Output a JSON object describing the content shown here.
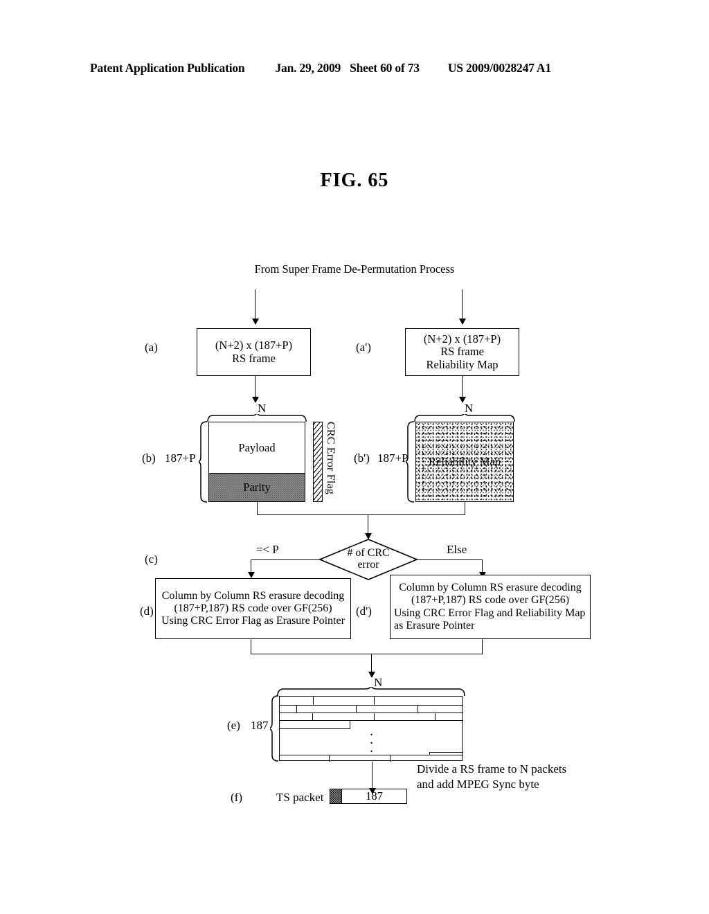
{
  "header": {
    "publication": "Patent Application Publication",
    "date": "Jan. 29, 2009",
    "sheet": "Sheet 60 of 73",
    "number": "US 2009/0028247 A1"
  },
  "figure": {
    "title": "FIG. 65",
    "source_label": "From Super Frame De-Permutation Process"
  },
  "stages": {
    "a": {
      "tag": "(a)",
      "box_line1": "(N+2) x (187+P)",
      "box_line2": "RS frame"
    },
    "a_prime": {
      "tag": "(a')",
      "box_line1": "(N+2) x (187+P)",
      "box_line2": "RS frame",
      "box_line3": "Reliability Map"
    },
    "b": {
      "tag": "(b)",
      "row_label": "187+P",
      "col_label": "N",
      "payload_label": "Payload",
      "parity_label": "Parity",
      "crc_flag_label": "CRC Error Flag"
    },
    "b_prime": {
      "tag": "(b')",
      "row_label": "187+P",
      "col_label": "N",
      "map_label": "Reliability Map"
    },
    "c": {
      "tag": "(c)",
      "decision_line1": "# of CRC",
      "decision_line2": "error",
      "branch_left": "=< P",
      "branch_right": "Else"
    },
    "d": {
      "tag": "(d)",
      "line1": "Column by Column RS erasure decoding",
      "line2": "(187+P,187) RS code over GF(256)",
      "line3": "Using CRC Error Flag as Erasure Pointer"
    },
    "d_prime": {
      "tag": "(d')",
      "line1": "Column by Column RS erasure decoding",
      "line2": "(187+P,187) RS code over GF(256)",
      "line3": "Using CRC Error Flag and Reliability Map",
      "line4": "as Erasure Pointer"
    },
    "e": {
      "tag": "(e)",
      "row_label": "187",
      "col_label": "N",
      "vertical_dots": "·\n·\n·"
    },
    "f": {
      "tag": "(f)",
      "packet_label": "TS packet",
      "packet_size": "187",
      "note_line1": "Divide a RS frame to N packets",
      "note_line2": "and add MPEG Sync byte"
    }
  }
}
